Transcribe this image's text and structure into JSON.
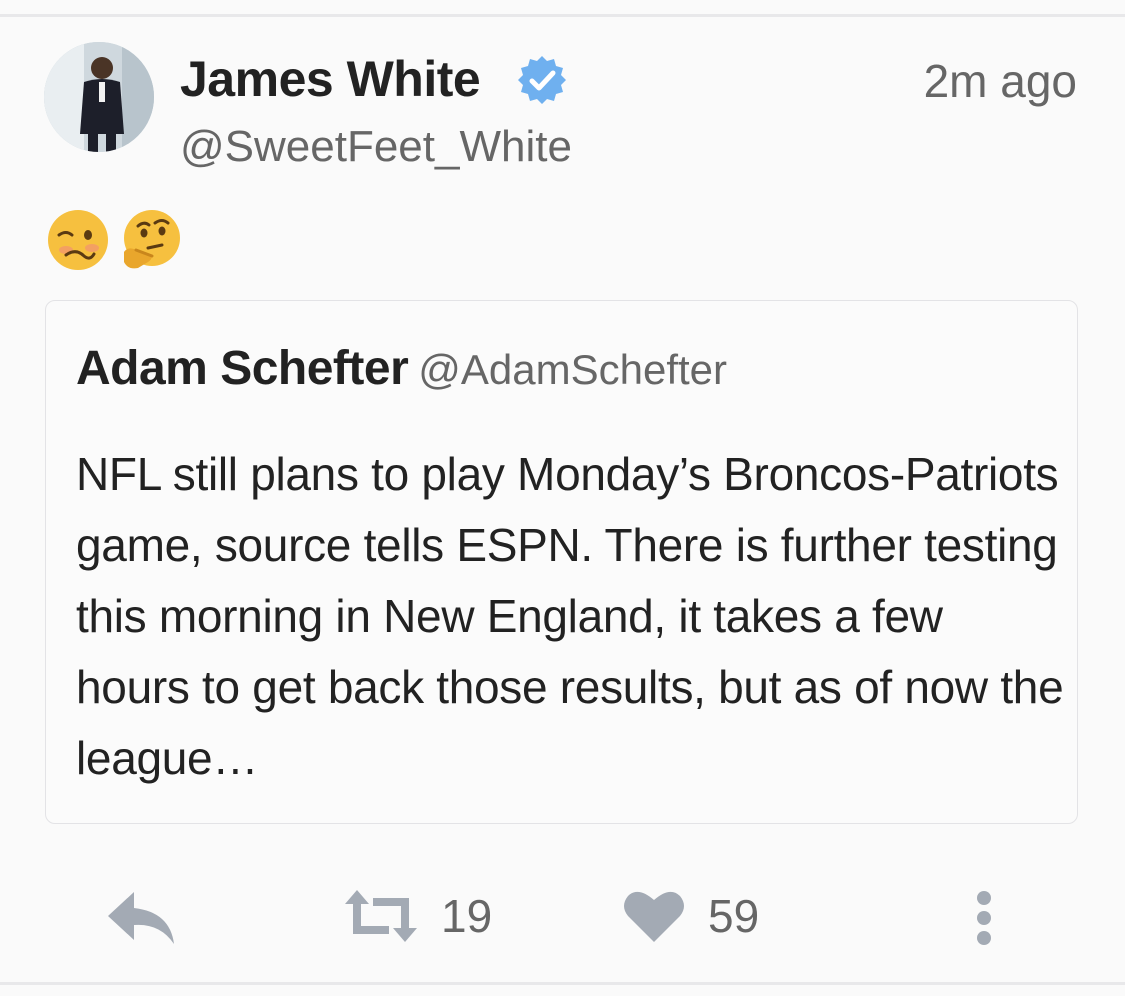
{
  "tweet": {
    "author_name": "James White",
    "author_handle": "@SweetFeet_White",
    "time": "2m ago",
    "verified": true,
    "emojis": [
      "woozy-face",
      "thinking-face"
    ],
    "quoted": {
      "author_name": "Adam Schefter",
      "author_handle": "@AdamSchefter",
      "text": "NFL still plans to play Monday’s Broncos-Patriots game, source tells ESPN. There is further testing this morning in New England, it takes a few hours to get back those results, but as of now the league…"
    },
    "actions": {
      "reply_icon": "reply-icon",
      "retweet_icon": "retweet-icon",
      "retweet_count": "19",
      "like_icon": "heart-icon",
      "like_count": "59",
      "more_icon": "more-vertical-icon"
    }
  },
  "colors": {
    "icon_gray": "#a3aab4",
    "verified_blue": "#6fb0ef",
    "text_primary": "#222222",
    "text_secondary": "#666666",
    "emoji_yellow": "#f6c03f"
  }
}
